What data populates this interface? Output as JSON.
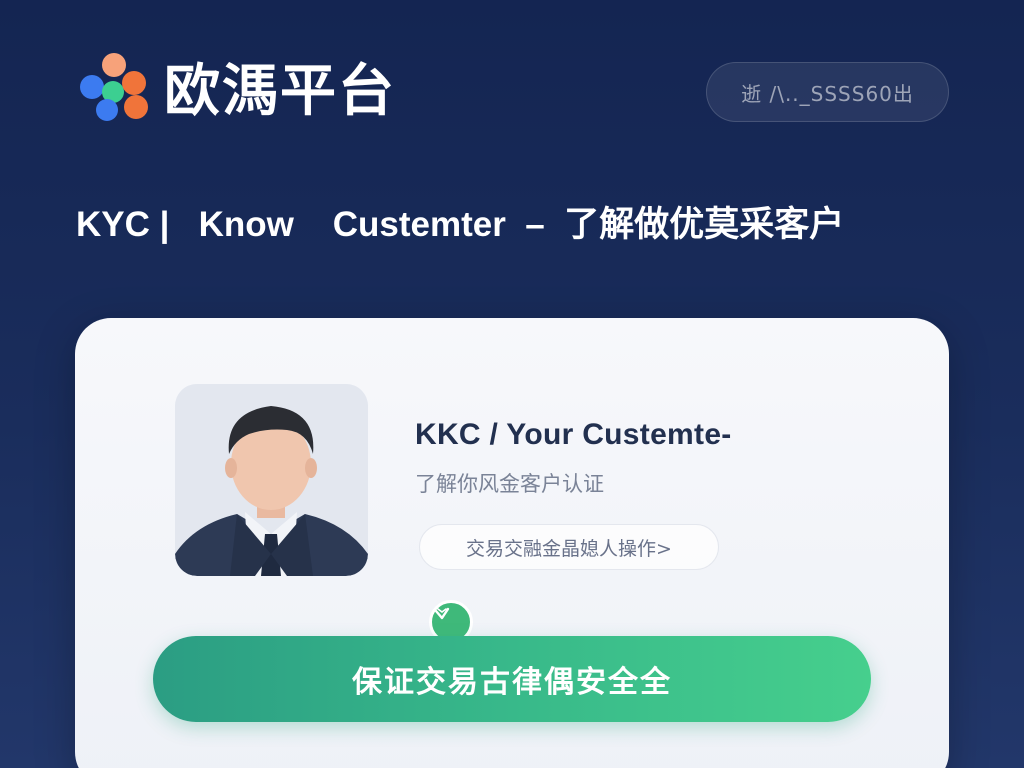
{
  "header": {
    "logo_text": "欧溤平台",
    "lang_pill": "逝 /\\.._SSSS60出"
  },
  "headline": "KYC |   Know    Custemter  –  了解做优莫采客户",
  "card": {
    "title": "KKC / Your Custemte-",
    "subtitle": "了解你风金客户认证",
    "chip": "交易交融金晶媳人操作>",
    "cta": "保证交易古律偶安全全"
  },
  "colors": {
    "background": "#142552",
    "accent_green": "#3fb97a",
    "card_bg": "#f4f6fa"
  },
  "icons": {
    "logo": "colorful-dots-logo",
    "avatar": "businessman-avatar",
    "badge": "verified-check-icon"
  }
}
